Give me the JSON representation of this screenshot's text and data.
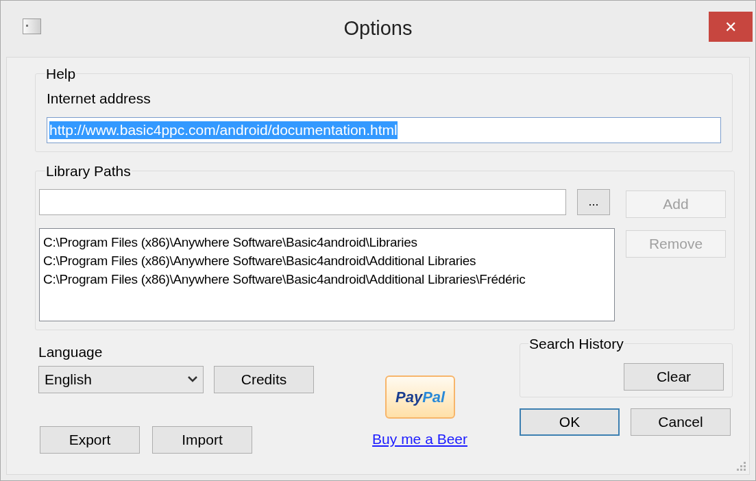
{
  "window": {
    "title": "Options",
    "close": "✕"
  },
  "help": {
    "legend": "Help",
    "address_label": "Internet address",
    "address": {
      "value": "http://www.basic4ppc.com/android/documentation.html",
      "selected": true
    }
  },
  "library_paths": {
    "legend": "Library Paths",
    "browse": "...",
    "add": {
      "label": "Add",
      "disabled": true
    },
    "remove": {
      "label": "Remove",
      "disabled": true
    },
    "items": [
      {
        "text": "C:\\Program Files (x86)\\Anywhere Software\\Basic4android\\Libraries",
        "selected": false
      },
      {
        "text": "C:\\Program Files (x86)\\Anywhere Software\\Basic4android\\Additional Libraries",
        "selected": false
      },
      {
        "text": "C:\\Program Files (x86)\\Anywhere Software\\Basic4android\\Additional Libraries\\Frédéric",
        "selected": false
      }
    ]
  },
  "language": {
    "label": "Language",
    "value": "English"
  },
  "credits": "Credits",
  "search_history": {
    "legend": "Search History",
    "clear": "Clear"
  },
  "export": "Export",
  "import": "Import",
  "paypal": {
    "pay": "Pay",
    "pal": "Pal"
  },
  "beer_link": "Buy me a Beer",
  "ok": {
    "label": "OK",
    "default": true
  },
  "cancel": "Cancel"
}
